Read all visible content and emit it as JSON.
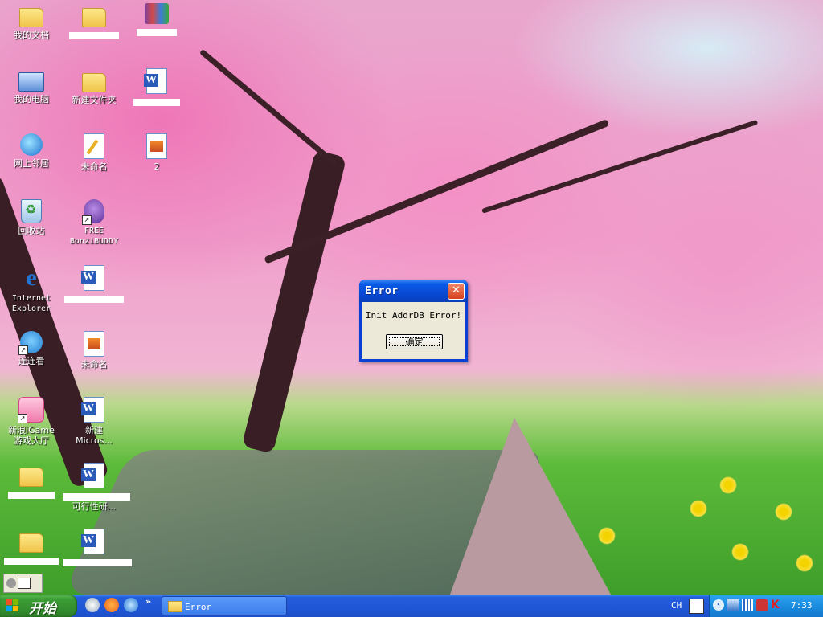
{
  "desktop": {
    "icons": [
      {
        "label": "我的文档"
      },
      {
        "label": "我的电脑"
      },
      {
        "label": "网上邻居"
      },
      {
        "label": "回收站"
      },
      {
        "label": "Internet Explorer"
      },
      {
        "label": "连连看"
      },
      {
        "label": "新浪iGame游戏大厅"
      },
      {
        "label": "新建文件夹"
      },
      {
        "label": "未命名"
      },
      {
        "label": "FREE BonziBUDDY"
      },
      {
        "label": "未命名"
      },
      {
        "label": "新建 Micros..."
      },
      {
        "label": "可行性研..."
      },
      {
        "label": "2"
      }
    ]
  },
  "dialog": {
    "title": "Error",
    "message": "Init AddrDB Error!",
    "ok_label": "确定",
    "close_glyph": "✕"
  },
  "taskbar": {
    "start_label": "开始",
    "quick_launch_more": "»",
    "task_label": "Error",
    "language": "CH",
    "tray_chevron": "‹",
    "clock": "7:33"
  },
  "colors": {
    "taskbar_blue": "#245edb",
    "start_green": "#3c9e36",
    "dialog_face": "#ece9d8"
  }
}
